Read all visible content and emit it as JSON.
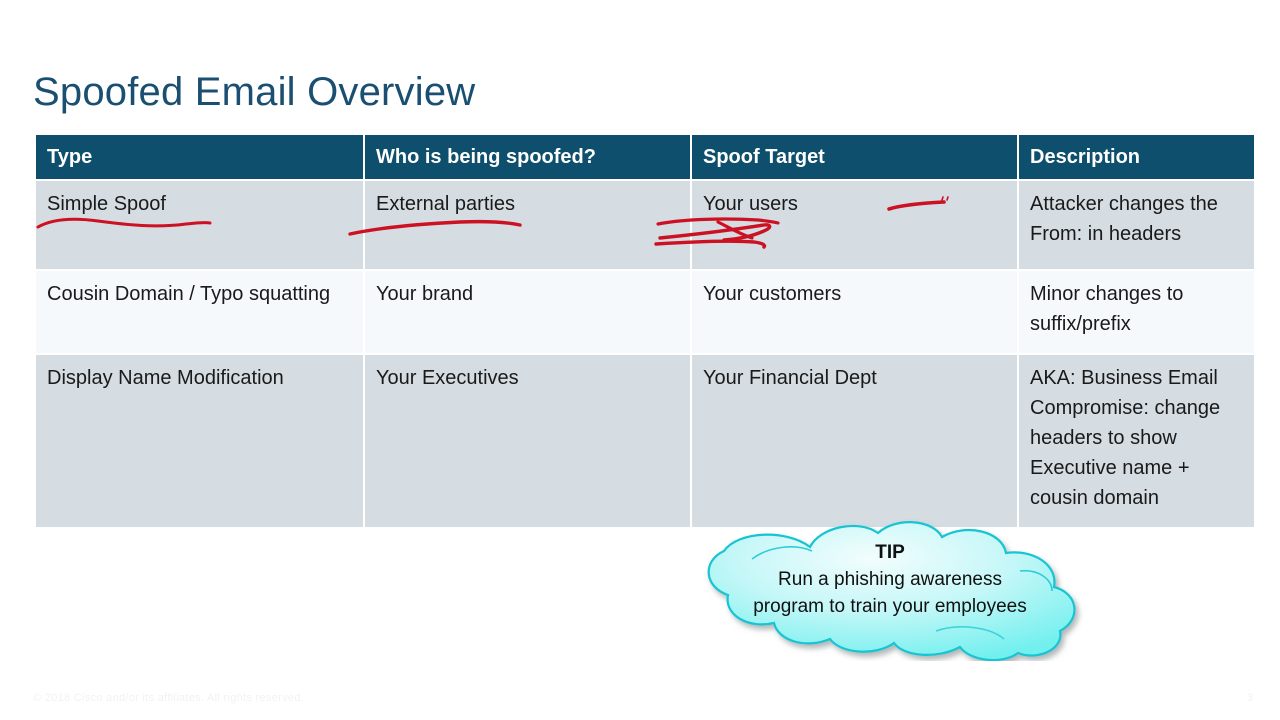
{
  "slide": {
    "title": "Spoofed Email Overview",
    "title_color": "#1b4f72"
  },
  "table": {
    "header_bg": "#0d4f6c",
    "row_shaded_bg": "#d5dce2",
    "row_light_bg": "#f6f9fb",
    "columns": [
      "Type",
      "Who is being spoofed?",
      "Spoof Target",
      "Description"
    ],
    "rows": [
      {
        "type": "Simple Spoof",
        "who": "External parties",
        "target": "Your users",
        "description": "Attacker changes the From: in headers"
      },
      {
        "type": "Cousin Domain / Typo squatting",
        "who": "Your brand",
        "target": "Your customers",
        "description": "Minor changes to suffix/prefix"
      },
      {
        "type": "Display Name Modification",
        "who": "Your Executives",
        "target": "Your Financial Dept",
        "description": "AKA: Business Email Compromise: change headers to show Executive name + cousin domain"
      }
    ]
  },
  "annotations": {
    "ink_color": "#cc1122",
    "marks": [
      "underline-simple-spoof",
      "underline-external-parties",
      "scribble-your-users",
      "dash-right-of-your-users"
    ]
  },
  "tip_cloud": {
    "heading": "TIP",
    "body": "Run a phishing awareness program to train your employees",
    "fill_light": "#e9fbfc",
    "fill_dark": "#72f0ee",
    "stroke": "#16c4d2"
  },
  "footer": {
    "copyright": "© 2018  Cisco and/or its affiliates. All rights reserved.",
    "page_number": "3"
  }
}
